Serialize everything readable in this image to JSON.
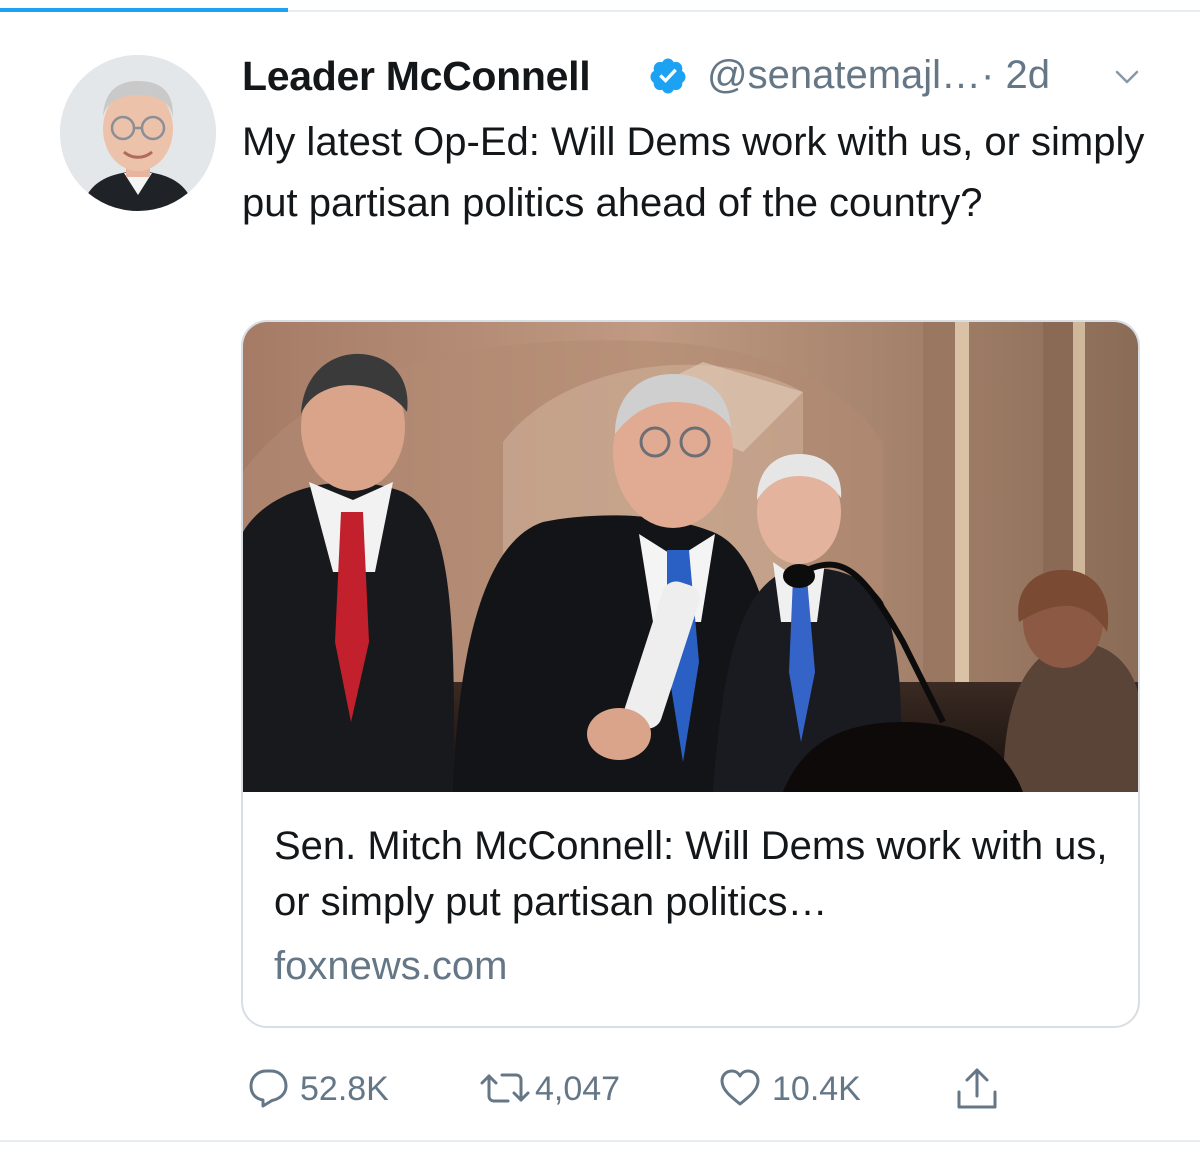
{
  "tweet": {
    "author": {
      "display_name": "Leader McConnell",
      "handle": "@senatemajl…",
      "verified": true,
      "avatar_icon": "profile-photo-portrait"
    },
    "timestamp": "· 2d",
    "text": "My latest Op-Ed: Will Dems work with us, or simply put partisan politics ahead of the country?",
    "card": {
      "image_icon": "news-photo-senators-at-podium",
      "title": "Sen. Mitch McConnell: Will Dems work with us, or simply put partisan politics…",
      "domain": "foxnews.com"
    },
    "actions": {
      "replies": "52.8K",
      "retweets": "4,047",
      "likes": "10.4K",
      "share_icon": "share-icon"
    }
  },
  "colors": {
    "accent": "#1da1f2",
    "verified_blue": "#1da1f2",
    "secondary_text": "#657786",
    "primary_text": "#14171a",
    "border": "#d8dee3"
  }
}
